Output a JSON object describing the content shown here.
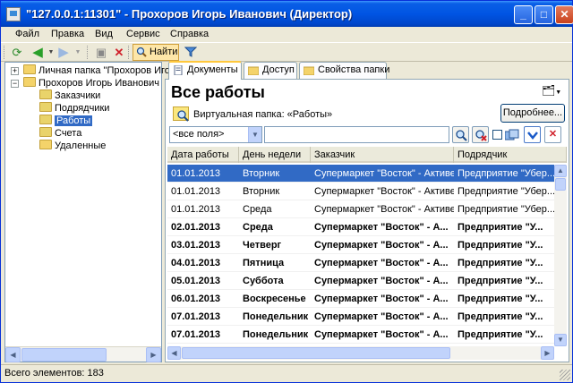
{
  "window": {
    "title": "\"127.0.0.1:11301\" - Прохоров Игорь Иванович (Директор)",
    "minimize": "_",
    "maximize": "□",
    "close": "✕"
  },
  "menu": [
    "Файл",
    "Правка",
    "Вид",
    "Сервис",
    "Справка"
  ],
  "toolbar": {
    "find_label": "Найти"
  },
  "tree": {
    "root_label": "Личная папка \"Прохоров Иго",
    "user_label": "Прохоров Игорь Иванович",
    "children": [
      "Заказчики",
      "Подрядчики",
      "Работы",
      "Счета",
      "Удаленные"
    ],
    "selected": "Работы"
  },
  "tabs": [
    "Документы",
    "Доступ",
    "Свойства папки"
  ],
  "main": {
    "title": "Все работы",
    "virtual_folder": "Виртуальная папка: «Работы»",
    "more_button": "Подробнее...",
    "filter_select": "<все поля>",
    "filter_value": ""
  },
  "grid": {
    "columns": [
      "Дата работы",
      "День недели",
      "Заказчик",
      "Подрядчик"
    ],
    "rows": [
      {
        "date": "01.01.2013",
        "day": "Вторник",
        "customer": "Супермаркет \"Восток\" - Активен",
        "contractor": "Предприятие \"Убер...",
        "bold": false
      },
      {
        "date": "01.01.2013",
        "day": "Вторник",
        "customer": "Супермаркет \"Восток\" - Активен",
        "contractor": "Предприятие \"Убер...",
        "bold": false
      },
      {
        "date": "01.01.2013",
        "day": "Среда",
        "customer": "Супермаркет \"Восток\" - Активен",
        "contractor": "Предприятие \"Убер...",
        "bold": false
      },
      {
        "date": "02.01.2013",
        "day": "Среда",
        "customer": "Супермаркет \"Восток\" - А...",
        "contractor": "Предприятие \"У...",
        "bold": true
      },
      {
        "date": "03.01.2013",
        "day": "Четверг",
        "customer": "Супермаркет \"Восток\" - А...",
        "contractor": "Предприятие \"У...",
        "bold": true
      },
      {
        "date": "04.01.2013",
        "day": "Пятница",
        "customer": "Супермаркет \"Восток\" - А...",
        "contractor": "Предприятие \"У...",
        "bold": true
      },
      {
        "date": "05.01.2013",
        "day": "Суббота",
        "customer": "Супермаркет \"Восток\" - А...",
        "contractor": "Предприятие \"У...",
        "bold": true
      },
      {
        "date": "06.01.2013",
        "day": "Воскресенье",
        "customer": "Супермаркет \"Восток\" - А...",
        "contractor": "Предприятие \"У...",
        "bold": true
      },
      {
        "date": "07.01.2013",
        "day": "Понедельник",
        "customer": "Супермаркет \"Восток\" - А...",
        "contractor": "Предприятие \"У...",
        "bold": true
      },
      {
        "date": "07.01.2013",
        "day": "Понедельник",
        "customer": "Супермаркет \"Восток\" - А...",
        "contractor": "Предприятие \"У...",
        "bold": true
      }
    ],
    "selected_row": 0
  },
  "status": {
    "count_text": "Всего элементов: 183"
  }
}
